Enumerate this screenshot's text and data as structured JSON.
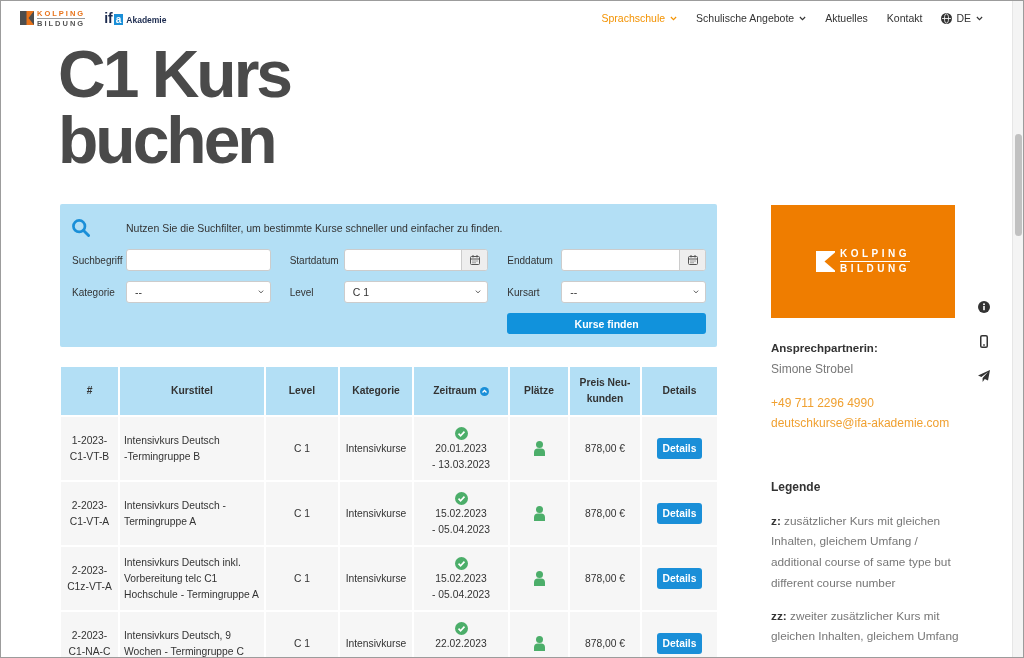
{
  "header": {
    "logo": {
      "line_1": "KOLPING",
      "line_2": "BILDUNG"
    },
    "partner_logo": {
      "mark": "if",
      "badge": "a",
      "name": "Akademie"
    },
    "nav": [
      {
        "label": "Sprachschule",
        "selected": true,
        "has_menu": true
      },
      {
        "label": "Schulische Angebote",
        "selected": false,
        "has_menu": true
      },
      {
        "label": "Aktuelles",
        "selected": false,
        "has_menu": false
      },
      {
        "label": "Kontakt",
        "selected": false,
        "has_menu": false
      }
    ],
    "language": {
      "label": "DE"
    }
  },
  "title": "C1 Kurs buchen",
  "search": {
    "intro": "Nutzen Sie die Suchfilter, um bestimmte Kurse schneller und einfacher zu finden.",
    "fields": [
      {
        "label": "Suchbegriff",
        "kind": "text"
      },
      {
        "label": "Startdatum",
        "kind": "date"
      },
      {
        "label": "Enddatum",
        "kind": "date"
      },
      {
        "label": "Kategorie",
        "kind": "select",
        "value": "--"
      },
      {
        "label": "Level",
        "kind": "select",
        "value": "C 1"
      },
      {
        "label": "Kursart",
        "kind": "select",
        "value": "--"
      }
    ],
    "button": "Kurse finden"
  },
  "table": {
    "columns": [
      {
        "label": "#",
        "sorted": false
      },
      {
        "label": "Kurstitel",
        "sorted": false
      },
      {
        "label": "Level",
        "sorted": false
      },
      {
        "label": "Kategorie",
        "sorted": false
      },
      {
        "label": "Zeitraum",
        "sorted": true
      },
      {
        "label": "Plätze",
        "sorted": false
      },
      {
        "label": "Preis Neu-kunden",
        "sorted": false
      },
      {
        "label": "Details",
        "sorted": false
      }
    ],
    "rows": [
      {
        "number": "1-2023-C1-VT-B",
        "title": "Intensivkurs Deutsch -Termingruppe B",
        "level": "C 1",
        "category": "Intensivkurse",
        "confirmed": true,
        "date_from": "20.01.2023",
        "date_to": "- 13.03.2023",
        "seats_available": true,
        "price": "878,00 €",
        "action": "Details"
      },
      {
        "number": "2-2023-C1-VT-A",
        "title": "Intensivkurs Deutsch - Termingruppe A",
        "level": "C 1",
        "category": "Intensivkurse",
        "confirmed": true,
        "date_from": "15.02.2023",
        "date_to": "- 05.04.2023",
        "seats_available": true,
        "price": "878,00 €",
        "action": "Details"
      },
      {
        "number": "2-2023-C1z-VT-A",
        "title": "Intensivkurs Deutsch inkl. Vorbereitung telc C1 Hochschule - Termingruppe A",
        "level": "C 1",
        "category": "Intensivkurse",
        "confirmed": true,
        "date_from": "15.02.2023",
        "date_to": "- 05.04.2023",
        "seats_available": true,
        "price": "878,00 €",
        "action": "Details"
      },
      {
        "number": "2-2023-C1-NA-C",
        "title": "Intensivkurs Deutsch, 9 Wochen - Termingruppe C",
        "level": "C 1",
        "category": "Intensivkurse",
        "confirmed": true,
        "date_from": "22.02.2023",
        "seats_available": true,
        "price": "878,00 €",
        "action": "Details"
      }
    ]
  },
  "sidebar": {
    "banner": {
      "line_1": "KOLPING",
      "line_2": "BILDUNG"
    },
    "contact": {
      "heading": "Ansprechpartnerin:",
      "name": "Simone Strobel",
      "phone": "+49 711 2296 4990",
      "email": "deutschkurse@ifa-akademie.com"
    },
    "legend": {
      "heading": "Legende",
      "items": [
        "**z:** zusätzlicher Kurs mit gleichen Inhalten, gleichem Umfang / additional course of same type but different course number",
        "**zz:** zweiter zusätzlicher Kurs mit gleichen Inhalten, gleichem Umfang"
      ]
    }
  }
}
